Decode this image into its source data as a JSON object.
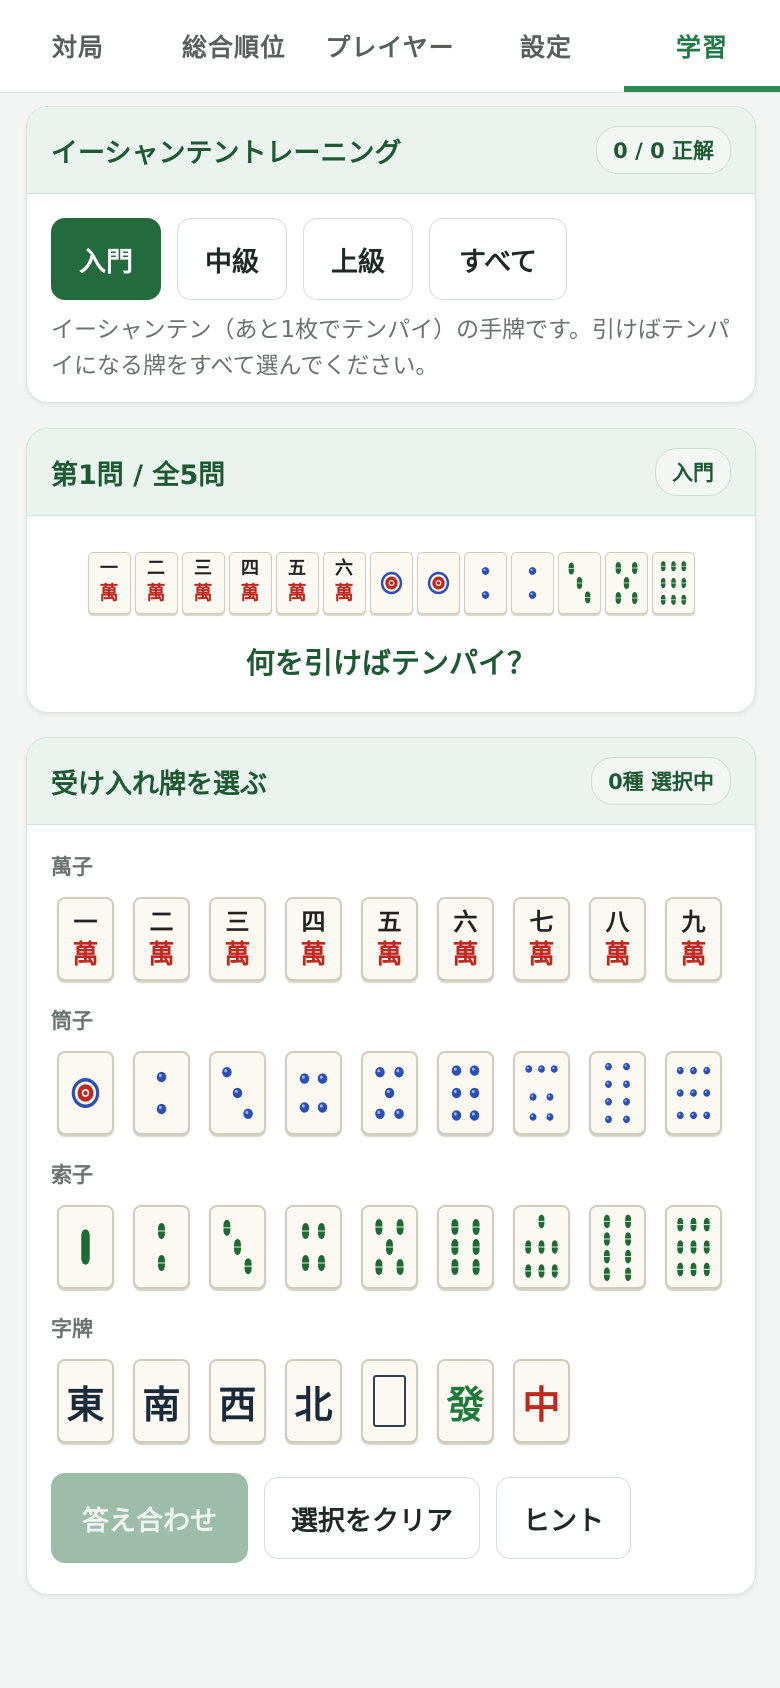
{
  "nav": {
    "tabs": [
      {
        "label": "対局",
        "active": false
      },
      {
        "label": "総合順位",
        "active": false
      },
      {
        "label": "プレイヤー",
        "active": false
      },
      {
        "label": "設定",
        "active": false
      },
      {
        "label": "学習",
        "active": true
      }
    ]
  },
  "training": {
    "title": "イーシャンテントレーニング",
    "score": "0 / 0 正解",
    "levels": [
      "入門",
      "中級",
      "上級",
      "すべて"
    ],
    "active_level": "入門",
    "description": "イーシャンテン（あと1枚でテンパイ）の手牌です。引けばテンパイになる牌をすべて選んでください。"
  },
  "question": {
    "title": "第1問 / 全5問",
    "level_badge": "入門",
    "hand": [
      "1m",
      "2m",
      "3m",
      "4m",
      "5m",
      "6m",
      "1p",
      "1p",
      "2p",
      "2p",
      "3s",
      "5s",
      "9s"
    ],
    "prompt": "何を引けばテンパイ？"
  },
  "picker": {
    "title": "受け入れ牌を選ぶ",
    "selected_count": "0種 選択中",
    "groups": {
      "man": {
        "label": "萬子",
        "tiles": [
          "1m",
          "2m",
          "3m",
          "4m",
          "5m",
          "6m",
          "7m",
          "8m",
          "9m"
        ]
      },
      "pin": {
        "label": "筒子",
        "tiles": [
          "1p",
          "2p",
          "3p",
          "4p",
          "5p",
          "6p",
          "7p",
          "8p",
          "9p"
        ]
      },
      "sou": {
        "label": "索子",
        "tiles": [
          "1s",
          "2s",
          "3s",
          "4s",
          "5s",
          "6s",
          "7s",
          "8s",
          "9s"
        ]
      },
      "honor": {
        "label": "字牌",
        "tiles": [
          "E",
          "S",
          "W",
          "N",
          "P",
          "F",
          "C"
        ]
      }
    },
    "actions": {
      "check": "答え合わせ",
      "clear": "選択をクリア",
      "hint": "ヒント"
    }
  },
  "tile_glyphs": {
    "man_numerals": [
      "一",
      "二",
      "三",
      "四",
      "五",
      "六",
      "七",
      "八",
      "九"
    ],
    "man_char": "萬",
    "honors": {
      "E": "東",
      "S": "南",
      "W": "西",
      "N": "北",
      "F": "發",
      "C": "中"
    }
  },
  "colors": {
    "accent": "#1f7a45",
    "pin_blue": "#2a4fb5",
    "sou_green": "#1c6b34",
    "man_red": "#c0281f"
  }
}
